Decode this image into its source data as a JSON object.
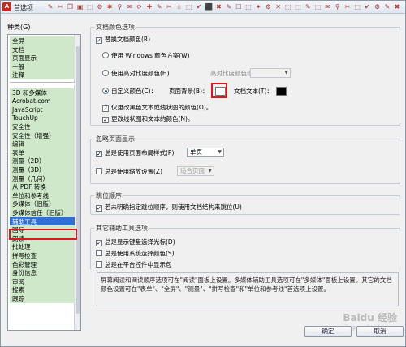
{
  "window": {
    "title": "首选项",
    "toolbar_icons": [
      "✎",
      "✂",
      "❐",
      "▣",
      "⬚",
      "⚙",
      "✱",
      "⚲",
      "✉",
      "⟳",
      "✚",
      "✎",
      "✂",
      "☆",
      "⬚",
      "✔",
      "⬛",
      "✖",
      "✎",
      "☐",
      "⬚",
      "✦",
      "⚙",
      "✕",
      "⬚",
      "⬚",
      "✎",
      "⬚",
      "✉",
      "⚲",
      "✂",
      "⬚",
      "✔",
      "⚙",
      "✎",
      "✖"
    ]
  },
  "categories": {
    "label": "种类(G)：",
    "items": [
      "全屏",
      "文档",
      "页面显示",
      "一般",
      "注释",
      "",
      "3D 和多媒体",
      "Acrobat.com",
      "JavaScript",
      "TouchUp",
      "安全性",
      "安全性（增强）",
      "编辑",
      "表单",
      "测量（2D）",
      "测量（3D）",
      "测量（几何）",
      "从 PDF 转换",
      "单位和参考线",
      "多媒体（旧版）",
      "多媒体信任（旧版）",
      "辅助工具",
      "国际",
      "朗读",
      "批处理",
      "拼写检查",
      "色彩管理",
      "身份信息",
      "审阅",
      "搜索",
      "跟踪"
    ],
    "selected": "辅助工具"
  },
  "doc_colors": {
    "title": "文档颜色选项",
    "replace_colors": "替换文档颜色(R)",
    "use_windows": "使用 Windows 颜色方案(W)",
    "use_high_contrast": "使用高对比度颜色(H)",
    "high_contrast_combo_label": "高对比度颜色组合(O)：",
    "high_contrast_combo_value": "",
    "custom_color": "自定义颜色(C)：",
    "page_bg_label": "页面背景(B)：",
    "doc_text_label": "文档文本(T)：",
    "page_bg_color": "#ffffff",
    "doc_text_color": "#000000",
    "only_black_text": "仅更改黑色文本或线状图的颜色(O)。",
    "change_line_art": "更改线状图和文本的颜色(N)。"
  },
  "override_page": {
    "title": "忽略页面显示",
    "always_layout": "总是使用页面布局样式(P)",
    "layout_value": "单页",
    "always_zoom": "总是使用缩放设置(Z)",
    "zoom_value": "适合页面"
  },
  "tab_order": {
    "title": "跳位顺序",
    "use_structure": "若未明确指定跳位顺序，则使用文档结构来跳位(U)"
  },
  "other": {
    "title": "其它辅助工具选项",
    "show_keyboard": "总是显示键盘选择光标(D)",
    "system_selection": "总是使用系统选择颜色(S)",
    "show_portfolio": "总是在平台控件中显示包"
  },
  "description": "屏幕阅读和阅读顺序选项可在\"阅读\"面板上设置。多媒体辅助工具选项可在\"多媒体\"面板上设置。其它的文档颜色设置可在\"表单\"、\"全屏\"、\"测量\"、\"拼写检查\"和\"单位和参考线\"首选项上设置。",
  "buttons": {
    "ok": "确定",
    "cancel": "取消"
  },
  "watermark": {
    "main": "Baidu 经验",
    "sub": "jingyan.baidu.com"
  }
}
